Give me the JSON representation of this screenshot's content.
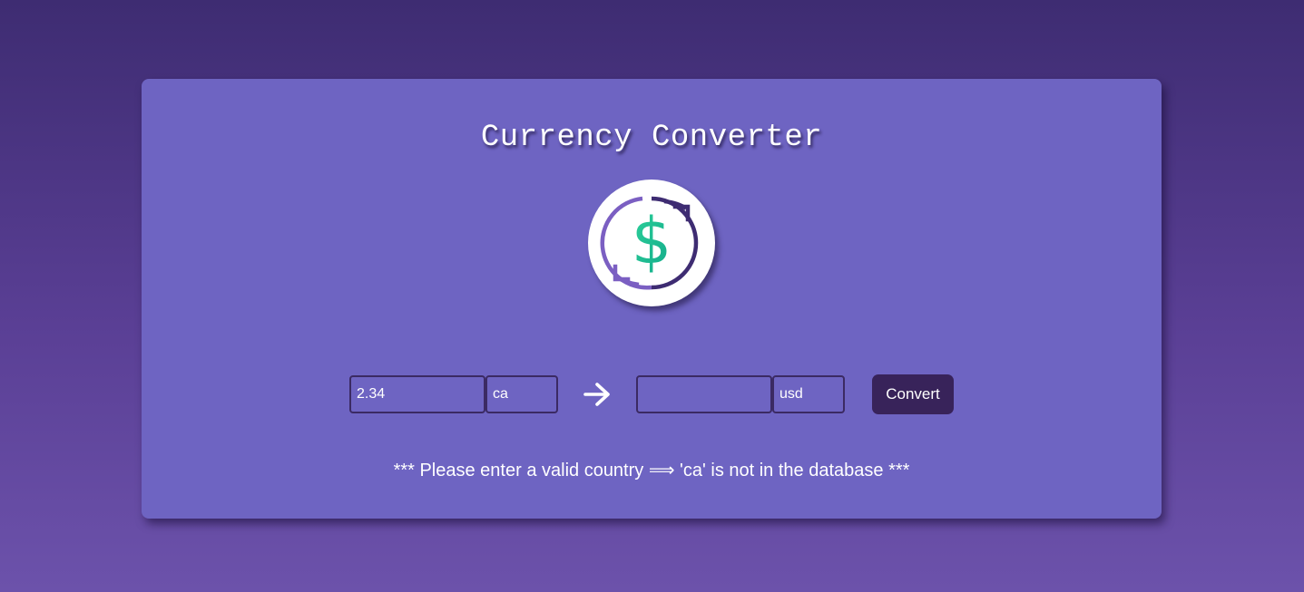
{
  "app": {
    "title": "Currency Converter",
    "logo_icon": "currency-exchange-icon",
    "logo_glyph": "$"
  },
  "converter": {
    "from_amount": "2.34",
    "from_country": "ca",
    "to_amount": "",
    "to_country": "usd",
    "arrow_icon": "arrow-right-icon",
    "convert_label": "Convert"
  },
  "status": {
    "message": "*** Please enter a valid country ⟹ 'ca' is not in the database ***"
  },
  "colors": {
    "background_top": "#3e2c72",
    "background_bottom": "#6c52ab",
    "card": "#6e64c2",
    "button": "#38235a",
    "dollar_green": "#1fbf8f"
  }
}
